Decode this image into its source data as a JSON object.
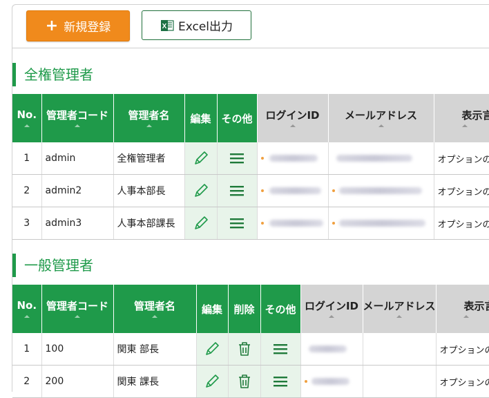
{
  "toolbar": {
    "new_label": "新規登録",
    "excel_label": "Excel出力"
  },
  "sections": [
    {
      "title": "全権管理者",
      "headers": [
        "No.",
        "管理者コード",
        "管理者名",
        "編集",
        "その他",
        "ログインID",
        "メールアドレス",
        "表示言"
      ],
      "rows": [
        {
          "no": "1",
          "code": "admin",
          "name": "全権管理者",
          "lang": "オプションの設"
        },
        {
          "no": "2",
          "code": "admin2",
          "name": "人事本部長",
          "lang": "オプションの設"
        },
        {
          "no": "3",
          "code": "admin3",
          "name": "人事本部課長",
          "lang": "オプションの設"
        }
      ]
    },
    {
      "title": "一般管理者",
      "headers": [
        "No.",
        "管理者コード",
        "管理者名",
        "編集",
        "削除",
        "その他",
        "ログインID",
        "メールアドレス",
        "表示言"
      ],
      "rows": [
        {
          "no": "1",
          "code": "100",
          "name": "関東 部長",
          "lang": "オプションの設"
        },
        {
          "no": "2",
          "code": "200",
          "name": "関東 課長",
          "lang": "オプションの設"
        }
      ]
    }
  ],
  "colors": {
    "accent_green": "#1f9a4a",
    "new_button_orange": "#f08a1c",
    "action_cell_bg": "#e8f4ea"
  },
  "icons": {
    "new": "plus-icon",
    "excel": "excel-icon",
    "edit": "pencil-icon",
    "delete": "trash-icon",
    "other": "hamburger-menu-icon"
  }
}
